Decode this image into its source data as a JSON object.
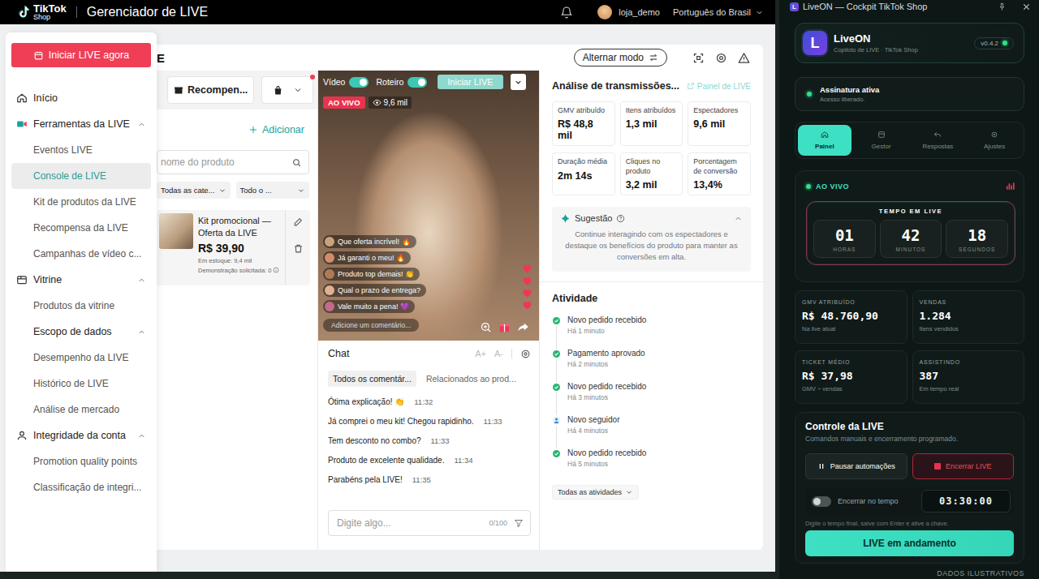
{
  "tiktok": {
    "header": {
      "brand": "TikTok",
      "brand_sub": "Shop",
      "title": "Gerenciador de LIVE",
      "user": "loja_demo",
      "language": "Português do Brasil"
    },
    "sidebar": {
      "cta": "Iniciar LIVE agora",
      "groups": [
        {
          "label": "Início",
          "kind": "link",
          "expanded": false,
          "items": []
        },
        {
          "label": "Ferramentas da LIVE",
          "kind": "group",
          "expanded": true,
          "items": [
            {
              "label": "Eventos LIVE",
              "selected": false
            },
            {
              "label": "Console de LIVE",
              "selected": true
            },
            {
              "label": "Kit de produtos da LIVE",
              "selected": false
            },
            {
              "label": "Recompensa da LIVE",
              "selected": false
            },
            {
              "label": "Campanhas de vídeo c...",
              "selected": false
            }
          ]
        },
        {
          "label": "Vitrine",
          "kind": "group",
          "expanded": true,
          "items": [
            {
              "label": "Produtos da vitrine",
              "selected": false
            }
          ]
        },
        {
          "label": "Escopo de dados",
          "kind": "group",
          "expanded": true,
          "items": [
            {
              "label": "Desempenho da LIVE",
              "selected": false
            },
            {
              "label": "Histórico de LIVE",
              "selected": false
            },
            {
              "label": "Análise de mercado",
              "selected": false
            }
          ]
        },
        {
          "label": "Integridade da conta",
          "kind": "group",
          "expanded": true,
          "items": [
            {
              "label": "Promotion quality points",
              "selected": false
            },
            {
              "label": "Classificação de integri...",
              "selected": false
            }
          ]
        }
      ]
    },
    "console": {
      "title": "E",
      "mode_button": "Alternar modo",
      "products": {
        "reward_tab": "Recompen...",
        "bag_alert": true,
        "add": "Adicionar",
        "search_placeholder": "nome do produto",
        "filters": [
          "Todas as cate...",
          "Todo o ..."
        ],
        "items": [
          {
            "name": "Kit promocional — Oferta da LIVE",
            "price": "R$ 39,90",
            "stock": "Em estoque: 9,4 mil",
            "demo": "Demonstração solicitada: 0"
          }
        ]
      },
      "stream": {
        "video_label": "Vídeo",
        "video_on": true,
        "script_label": "Roteiro",
        "script_on": true,
        "start_button": "Iniciar LIVE",
        "start_disabled": true,
        "live_badge": "AO VIVO",
        "viewers": "9,6 mil",
        "overlay_comments": [
          "Que oferta incrível! 🔥",
          "Já garanti o meu! 🔥",
          "Produto top demais! 👏",
          "Qual o prazo de entrega?",
          "Vale muito a pena! 💜"
        ],
        "comment_placeholder": "Adicione um comentário...",
        "hearts": 4
      },
      "chat": {
        "title": "Chat",
        "font_up": "A+",
        "font_down": "A-",
        "tabs": [
          {
            "label": "Todos os comentár...",
            "selected": true
          },
          {
            "label": "Relacionados ao prod...",
            "selected": false
          }
        ],
        "messages": [
          {
            "text": "Ótima explicação! 👏",
            "time": "11:32"
          },
          {
            "text": "Já comprei o meu kit! Chegou rapidinho.",
            "time": "11:33"
          },
          {
            "text": "Tem desconto no combo?",
            "time": "11:33"
          },
          {
            "text": "Produto de excelente qualidade.",
            "time": "11:34"
          },
          {
            "text": "Parabéns pela LIVE!",
            "time": "11:35"
          }
        ],
        "input_placeholder": "Digite algo...",
        "counter": "0/100"
      },
      "analysis": {
        "title": "Análise de transmissões...",
        "link": "Painel de LIVE",
        "metrics": [
          {
            "label": "GMV atribuído",
            "value": "R$ 48,8 mil"
          },
          {
            "label": "Itens atribuídos",
            "value": "1,3 mil"
          },
          {
            "label": "Espectadores",
            "value": "9,6 mil"
          },
          {
            "label": "Duração média",
            "value": "2m 14s"
          },
          {
            "label": "Cliques no produto",
            "value": "3,2 mil"
          },
          {
            "label": "Porcentagem de conversão",
            "value": "13,4%"
          }
        ],
        "suggestion": {
          "title": "Sugestão",
          "expanded": true,
          "text": "Continue interagindo com os espectadores e destaque os benefícios do produto para manter as conversões em alta."
        },
        "activity": {
          "title": "Atividade",
          "items": [
            {
              "text": "Novo pedido recebido",
              "time": "Há 1 minuto",
              "kind": "check"
            },
            {
              "text": "Pagamento aprovado",
              "time": "Há 2 minutos",
              "kind": "check"
            },
            {
              "text": "Novo pedido recebido",
              "time": "Há 3 minutos",
              "kind": "check"
            },
            {
              "text": "Novo seguidor",
              "time": "Há 4 minutos",
              "kind": "follower"
            },
            {
              "text": "Novo pedido recebido",
              "time": "Há 5 minutos",
              "kind": "check"
            }
          ],
          "filter": "Todas as atividades"
        }
      }
    }
  },
  "liveon": {
    "title": "LiveON — Cockpit TikTok Shop",
    "logo": "L",
    "name": "LiveON",
    "tagline": "Copiloto de LIVE · TikTok Shop",
    "version": "v0.4.2",
    "online": true,
    "subscription": {
      "title": "Assinatura ativa",
      "subtitle": "Acesso liberado.",
      "active": true
    },
    "nav": [
      {
        "label": "Painel",
        "selected": true
      },
      {
        "label": "Gestor",
        "selected": false
      },
      {
        "label": "Respostas",
        "selected": false
      },
      {
        "label": "Ajustes",
        "selected": false
      }
    ],
    "live": {
      "status": "AO VIVO",
      "timer_title": "TEMPO EM LIVE",
      "timer": [
        {
          "value": "01",
          "unit": "HORAS"
        },
        {
          "value": "42",
          "unit": "MINUTOS"
        },
        {
          "value": "18",
          "unit": "SEGUNDOS"
        }
      ]
    },
    "stats": [
      {
        "label": "GMV ATRIBUÍDO",
        "value": "R$ 48.760,90",
        "note": "Na live atual"
      },
      {
        "label": "VENDAS",
        "value": "1.284",
        "note": "Itens vendidos"
      },
      {
        "label": "TICKET MÉDIO",
        "value": "R$ 37,98",
        "note": "GMV ÷ vendas"
      },
      {
        "label": "ASSISTINDO",
        "value": "387",
        "note": "Em tempo real"
      }
    ],
    "control": {
      "title": "Controle da LIVE",
      "subtitle": "Comandos manuais e encerramento programado.",
      "pause_button": "Pausar automações",
      "end_button": "Encerrar LIVE",
      "auto_end_label": "Encerrar no tempo",
      "auto_end_on": false,
      "end_time": "03:30:00",
      "hint": "Digite o tempo final, salve com Enter e ative a chave.",
      "status_button": "LIVE em andamento"
    }
  },
  "footer_note": "DADOS ILUSTRATIVOS"
}
